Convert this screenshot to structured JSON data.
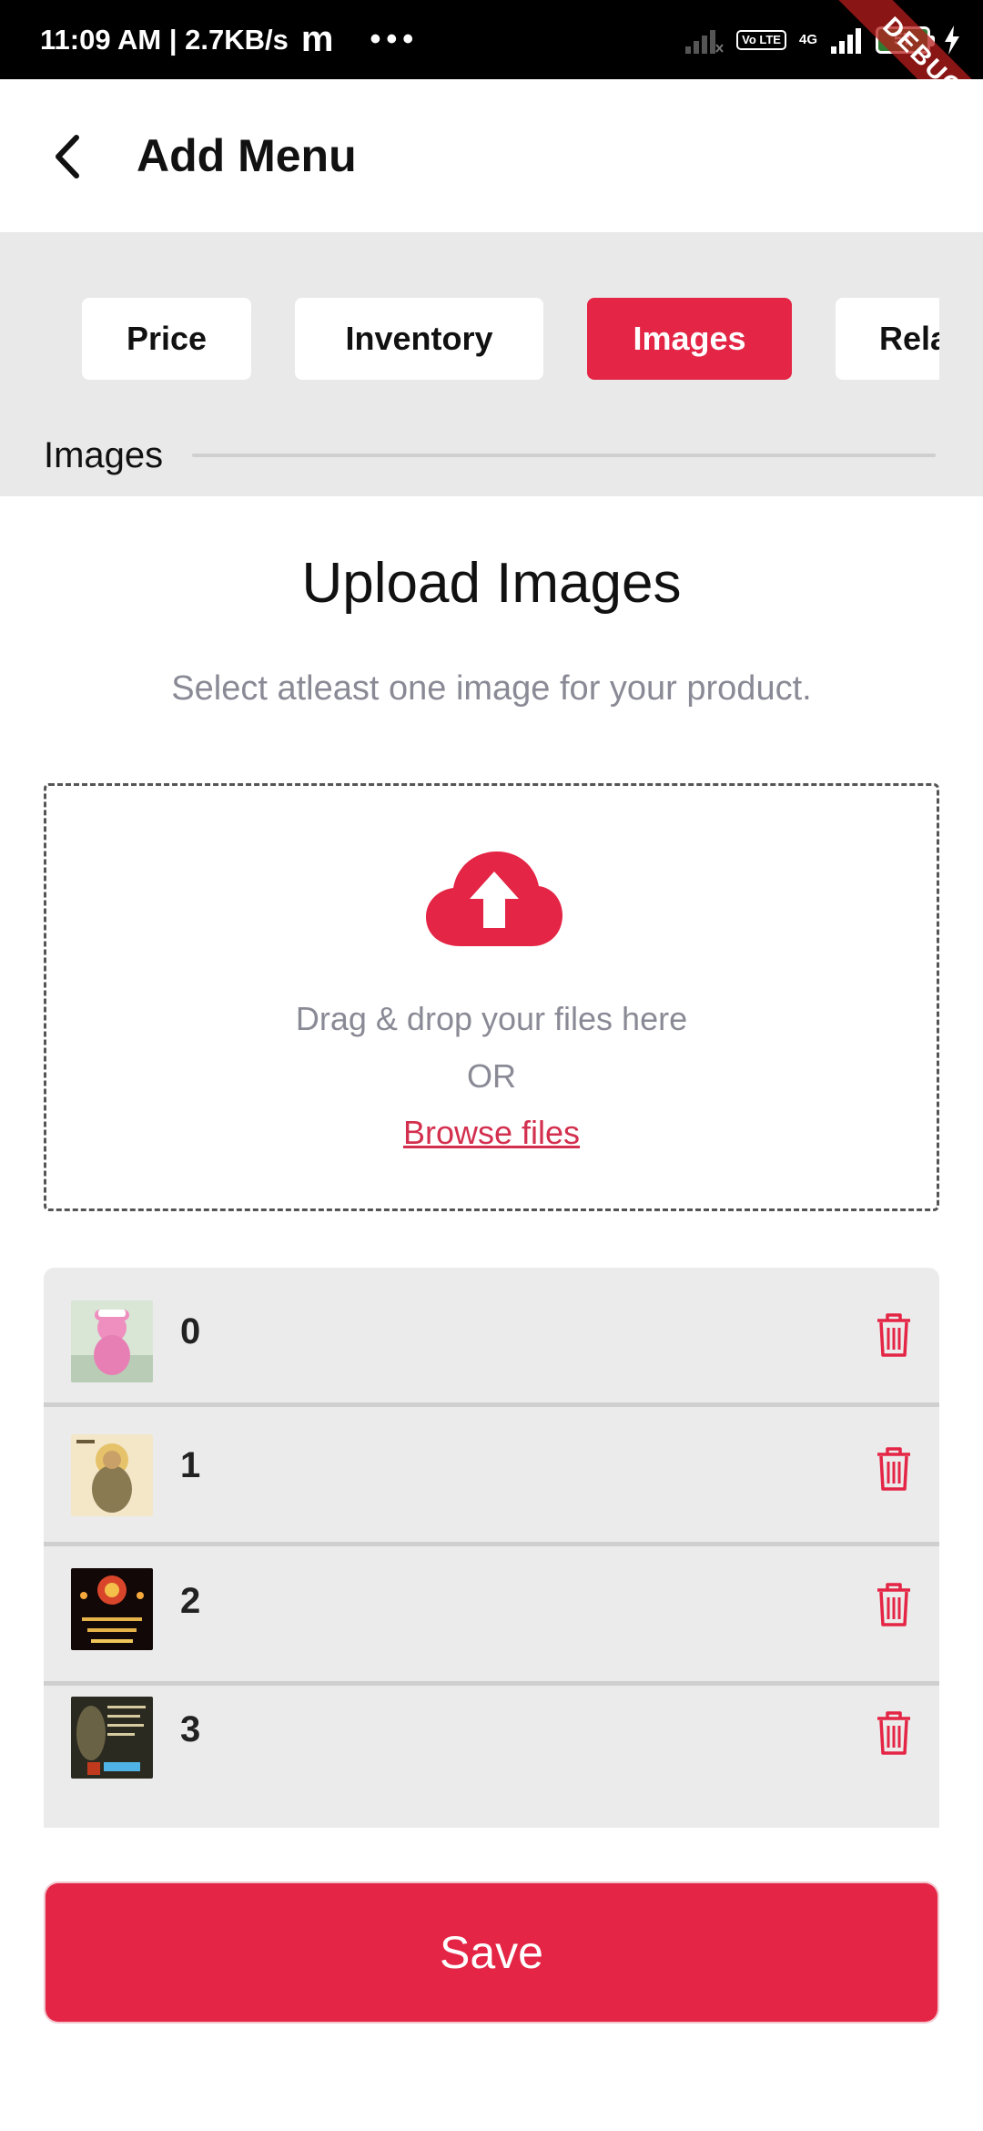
{
  "status_bar": {
    "time_speed": "11:09 AM | 2.7KB/s",
    "app_glyph": "m",
    "more": "•••",
    "volte": "Vo LTE",
    "network": "4G",
    "battery": "57"
  },
  "debug_banner": "DEBUG",
  "app_bar": {
    "back_icon": "chevron-left-icon",
    "title": "Add Menu"
  },
  "tabs": [
    {
      "label": "Price",
      "active": false
    },
    {
      "label": "Inventory",
      "active": false
    },
    {
      "label": "Images",
      "active": true
    },
    {
      "label": "Rela",
      "active": false
    }
  ],
  "section": {
    "label": "Images"
  },
  "upload": {
    "title": "Upload Images",
    "subtitle": "Select atleast one image for your product.",
    "icon": "cloud-upload-icon",
    "drop_text": "Drag & drop your files here",
    "or_text": "OR",
    "browse_label": "Browse files"
  },
  "images": [
    {
      "label": "0",
      "delete_icon": "trash-icon"
    },
    {
      "label": "1",
      "delete_icon": "trash-icon"
    },
    {
      "label": "2",
      "delete_icon": "trash-icon"
    },
    {
      "label": "3",
      "delete_icon": "trash-icon"
    }
  ],
  "save_label": "Save",
  "colors": {
    "accent": "#e42545",
    "link": "#d32f4e",
    "muted_text": "#8a8a96",
    "panel_bg": "#e9e9e9"
  }
}
